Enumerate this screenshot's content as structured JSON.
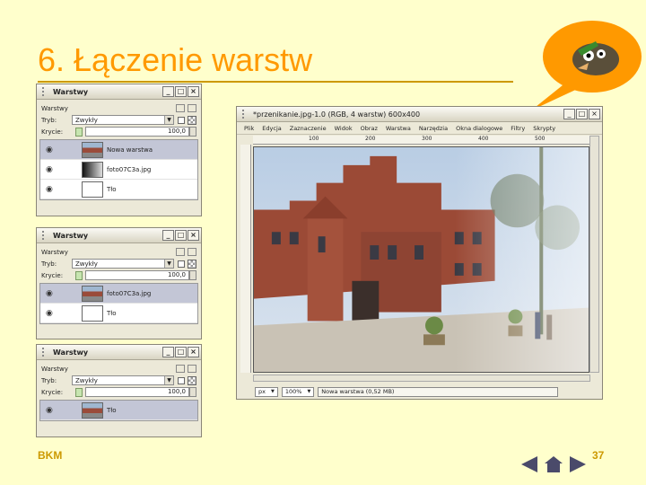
{
  "slide": {
    "title": "6. Łączenie warstw",
    "footer_left": "BKM",
    "page_number": "37",
    "accent_color": "#FF9900"
  },
  "panels": [
    {
      "title": "Warstwy",
      "mode_label": "Warstwy",
      "tryb_label": "Tryb:",
      "tryb_value": "Zwykły",
      "krycie_label": "Krycie:",
      "krycie_value": "100,0",
      "layers": [
        {
          "name": "Nowa warstwa",
          "thumb": "photo",
          "visible": true,
          "selected": true
        },
        {
          "name": "foto07C3a.jpg",
          "thumb": "blackwhite",
          "visible": true,
          "selected": false
        },
        {
          "name": "Tło",
          "thumb": "white",
          "visible": true,
          "selected": false
        }
      ]
    },
    {
      "title": "Warstwy",
      "mode_label": "Warstwy",
      "tryb_label": "Tryb:",
      "tryb_value": "Zwykły",
      "krycie_label": "Krycie:",
      "krycie_value": "100,0",
      "layers": [
        {
          "name": "foto07C3a.jpg",
          "thumb": "photo",
          "visible": true,
          "selected": true
        },
        {
          "name": "Tło",
          "thumb": "white",
          "visible": true,
          "selected": false
        }
      ]
    },
    {
      "title": "Warstwy",
      "mode_label": "Warstwy",
      "tryb_label": "Tryb:",
      "tryb_value": "Zwykły",
      "krycie_label": "Krycie:",
      "krycie_value": "100,0",
      "layers": [
        {
          "name": "Tło",
          "thumb": "photo",
          "visible": true,
          "selected": true
        }
      ]
    }
  ],
  "image_window": {
    "title": "*przenikanie.jpg-1.0 (RGB, 4 warstw) 600x400",
    "menu": [
      "Plik",
      "Edycja",
      "Zaznaczenie",
      "Widok",
      "Obraz",
      "Warstwa",
      "Narzędzia",
      "Okna dialogowe",
      "Filtry",
      "Skrypty"
    ],
    "ruler_ticks": [
      "100",
      "200",
      "300",
      "400",
      "500"
    ],
    "unit": "px",
    "zoom": "100%",
    "status": "Nowa warstwa (0,52 MB)"
  }
}
